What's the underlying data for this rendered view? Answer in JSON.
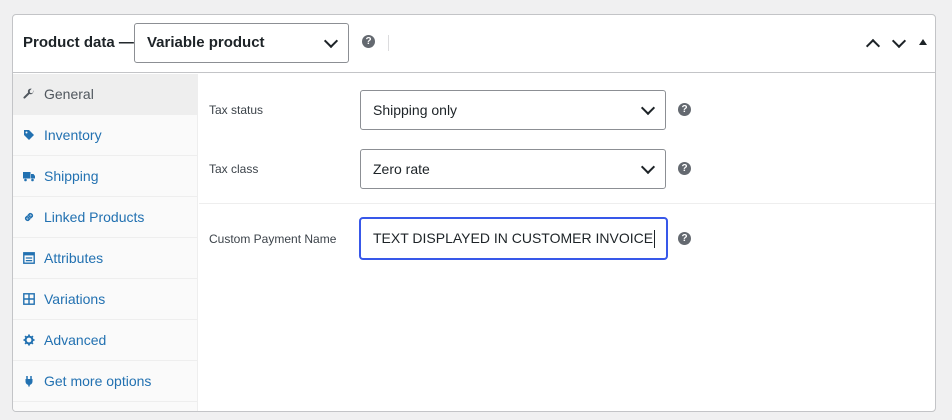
{
  "header": {
    "title": "Product data —",
    "product_type": "Variable product",
    "help": "?"
  },
  "sidebar": {
    "items": [
      {
        "label": "General",
        "icon": "wrench-icon",
        "active": true
      },
      {
        "label": "Inventory",
        "icon": "tag-icon"
      },
      {
        "label": "Shipping",
        "icon": "truck-icon"
      },
      {
        "label": "Linked Products",
        "icon": "link-icon"
      },
      {
        "label": "Attributes",
        "icon": "list-icon"
      },
      {
        "label": "Variations",
        "icon": "grid-icon"
      },
      {
        "label": "Advanced",
        "icon": "gear-icon"
      },
      {
        "label": "Get more options",
        "icon": "plugin-icon"
      }
    ]
  },
  "fields": {
    "tax_status": {
      "label": "Tax status",
      "value": "Shipping only",
      "help": "?"
    },
    "tax_class": {
      "label": "Tax class",
      "value": "Zero rate",
      "help": "?"
    },
    "custom_payment_name": {
      "label": "Custom Payment Name",
      "value": "TEXT DISPLAYED IN CUSTOMER INVOICE",
      "help": "?"
    }
  },
  "colors": {
    "accent": "#2271b1",
    "focus": "#3858e9",
    "border": "#c3c4c7"
  }
}
